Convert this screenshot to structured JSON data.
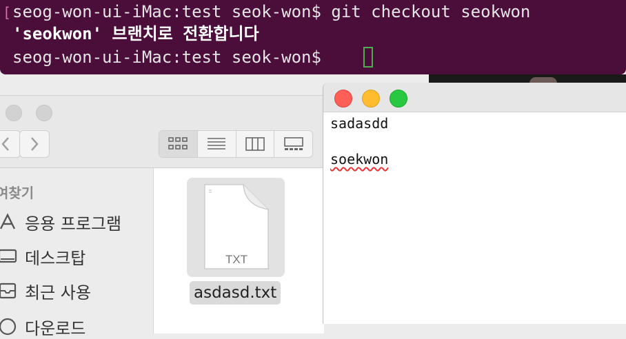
{
  "terminal": {
    "line1": "seog-won-ui-iMac:test seok-won$ git checkout seokwon",
    "line2": "'seokwon' 브랜치로 전환합니다",
    "line3": "seog-won-ui-iMac:test seok-won$ "
  },
  "finder": {
    "sidebar_heading": "여찾기",
    "sidebar_items": [
      {
        "label": "응용 프로그램",
        "icon": "applications-icon"
      },
      {
        "label": "데스크탑",
        "icon": "desktop-icon"
      },
      {
        "label": "최근 사용",
        "icon": "recents-icon"
      },
      {
        "label": "다운로드",
        "icon": "downloads-icon"
      }
    ],
    "file": {
      "name": "asdasd.txt",
      "type_label": "TXT"
    }
  },
  "textedit": {
    "lines": [
      "sadasdd",
      "",
      "soekwon"
    ]
  },
  "colors": {
    "terminal_bg": "#4b0e3a",
    "close": "#ff5f57",
    "minimize": "#febc2e",
    "zoom": "#28c840"
  }
}
